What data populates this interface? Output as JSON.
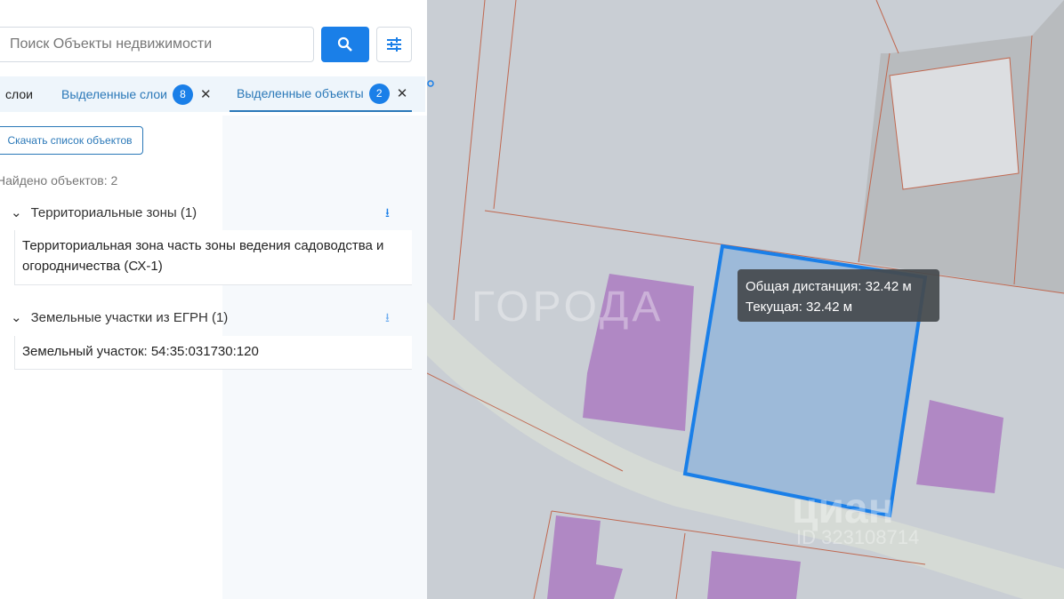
{
  "search": {
    "placeholder": "Поиск Объекты недвижимости"
  },
  "tabs": [
    {
      "label": "слои"
    },
    {
      "label": "Выделенные слои",
      "count": "8"
    },
    {
      "label": "Выделенные объекты",
      "count": "2"
    }
  ],
  "download_list_label": "Скачать список объектов",
  "found_text": "Найдено объектов: 2",
  "groups": [
    {
      "title": "Территориальные зоны (1)",
      "items": [
        "Территориальная зона часть зоны ведения садоводства и огородничества (СХ-1)"
      ]
    },
    {
      "title": "Земельные участки из ЕГРН (1)",
      "items": [
        "Земельный участок: 54:35:031730:120"
      ]
    }
  ],
  "tooltip": {
    "total": "Общая дистанция: 32.42 м",
    "current": "Текущая: 32.42 м"
  },
  "watermarks": {
    "gorod": "ГОРОДА",
    "cian": "циан",
    "cian_id": "ID 323108714"
  },
  "colors": {
    "accent": "#1a7fe8",
    "building": "#b088c4",
    "measure": "#1a7fe8"
  }
}
